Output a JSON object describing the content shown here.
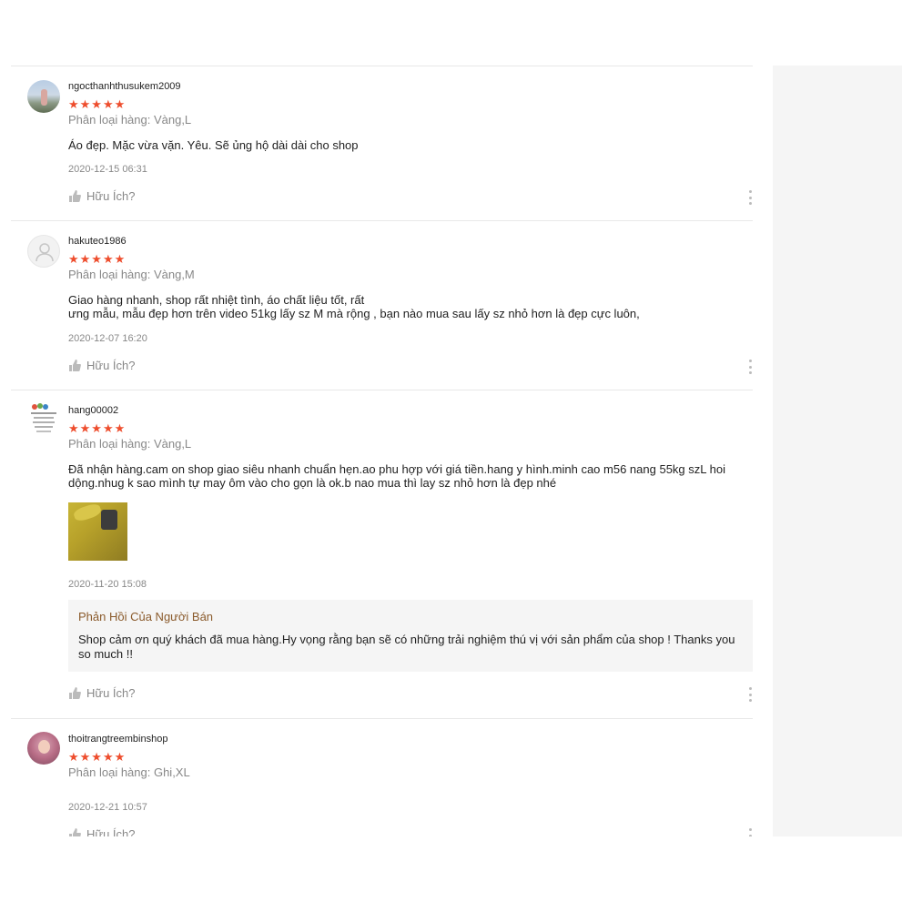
{
  "reviews": [
    {
      "username": "ngocthanhthusukem2009",
      "stars": "★★★★★",
      "variation": "Phân loại hàng: Vàng,L",
      "comment": "Áo đẹp. Mặc vừa vặn. Yêu. Sẽ ủng hộ dài dài cho shop",
      "time": "2020-12-15 06:31",
      "helpful": "Hữu Ích?"
    },
    {
      "username": "hakuteo1986",
      "stars": "★★★★★",
      "variation": "Phân loại hàng: Vàng,M",
      "comment": "Giao hàng nhanh, shop rất nhiệt tình, áo chất liệu tốt,  rất\n ưng mẫu, mẫu đẹp hơn trên video 51kg lấy sz M mà rộng ,  bạn nào mua sau lấy sz nhỏ hơn là đẹp cực luôn,",
      "time": "2020-12-07 16:20",
      "helpful": "Hữu Ích?"
    },
    {
      "username": "hang00002",
      "stars": "★★★★★",
      "variation": "Phân loại hàng: Vàng,L",
      "comment": "Đã nhận hàng.cam on shop giao siêu nhanh chuẩn hẹn.ao phu hợp với giá tiền.hang y hình.minh cao m56 nang 55kg szL hoi\ndộng.nhug k sao mình tự may ôm vào cho gọn là ok.b nao mua thì lay sz nhỏ hơn là đẹp nhé",
      "time": "2020-11-20 15:08",
      "seller_reply_title": "Phản Hồi Của Người Bán",
      "seller_reply": "Shop cảm ơn quý khách đã mua hàng.Hy vọng rằng bạn sẽ có những trải nghiệm thú vị với sản phẩm của shop ! Thanks you so much !!",
      "helpful": "Hữu Ích?"
    },
    {
      "username": "thoitrangtreembinshop",
      "stars": "★★★★★",
      "variation": "Phân loại hàng: Ghi,XL",
      "time": "2020-12-21 10:57",
      "helpful": "Hữu Ích?"
    }
  ],
  "colors": {
    "star": "#ee4d2d",
    "seller_title": "#8a5a2b",
    "muted": "#888888"
  },
  "icons": {
    "helpful": "thumbs-up-icon",
    "more": "more-vertical-icon",
    "default_avatar": "user-icon"
  }
}
